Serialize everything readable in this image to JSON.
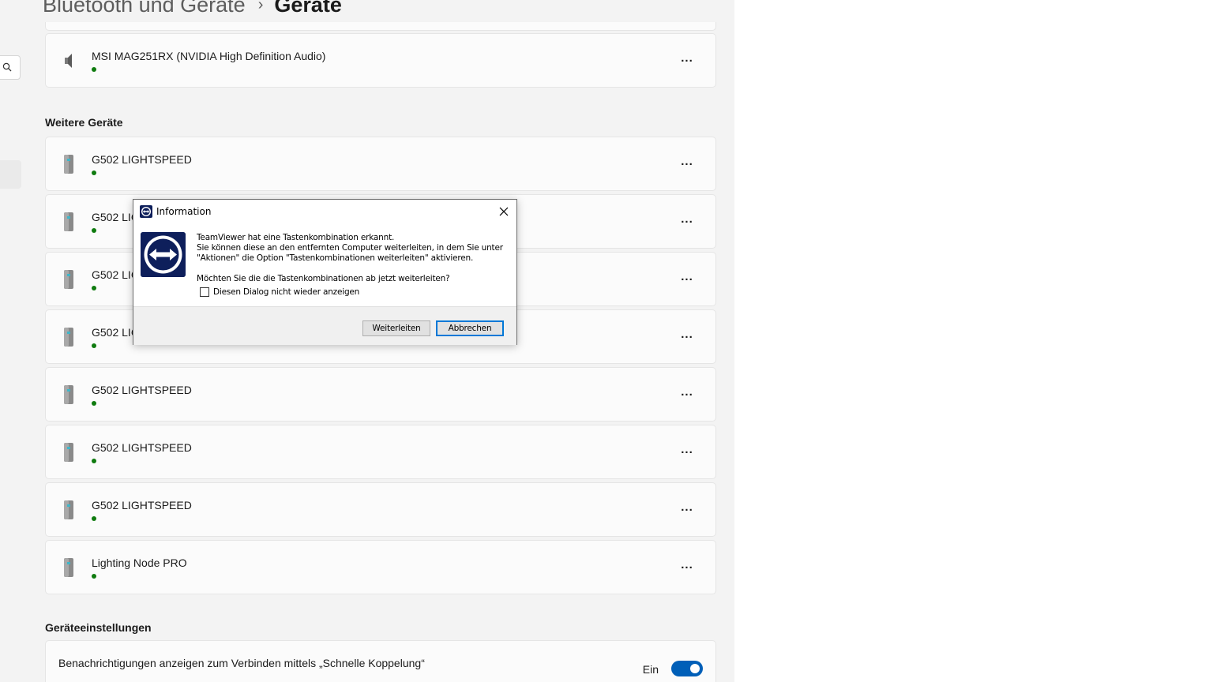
{
  "breadcrumb": {
    "parent": "Bluetooth und Geräte",
    "separator": "›",
    "current": "Geräte"
  },
  "audio_device": {
    "name": "MSI MAG251RX (NVIDIA High Definition Audio)",
    "icon": "speaker-icon"
  },
  "sections": {
    "other_devices": "Weitere Geräte",
    "device_settings": "Geräteeinstellungen"
  },
  "devices": [
    {
      "name": "G502 LIGHTSPEED",
      "icon": "device-icon"
    },
    {
      "name": "G502 LIGHTSPEED",
      "icon": "device-icon"
    },
    {
      "name": "G502 LIGHTSPEED",
      "icon": "device-icon"
    },
    {
      "name": "G502 LIGHTSPEED",
      "icon": "device-icon"
    },
    {
      "name": "G502 LIGHTSPEED",
      "icon": "device-icon"
    },
    {
      "name": "G502 LIGHTSPEED",
      "icon": "device-icon"
    },
    {
      "name": "G502 LIGHTSPEED",
      "icon": "device-icon"
    },
    {
      "name": "Lighting Node PRO",
      "icon": "device-icon"
    }
  ],
  "more_label": "...",
  "setting": {
    "label": "Benachrichtigungen anzeigen zum Verbinden mittels „Schnelle Koppelung“",
    "toggle_text": "Ein",
    "toggle_on": true
  },
  "dialog": {
    "title": "Information",
    "message_line1": "TeamViewer hat eine Tastenkombination erkannt.",
    "message_line2": "Sie können diese an den entfernten Computer weiterleiten, in dem Sie unter",
    "message_line3": "\"Aktionen\" die Option \"Tastenkombinationen weiterleiten\" aktivieren.",
    "question": "Möchten Sie die die Tastenkombinationen ab jetzt weiterleiten?",
    "checkbox_label": "Diesen Dialog nicht wieder anzeigen",
    "forward_button": "Weiterleiten",
    "cancel_button": "Abbrechen"
  },
  "colors": {
    "accent": "#005fb8",
    "status_dot": "#0f7b0f",
    "teamviewer_blue": "#0e1f5b"
  }
}
